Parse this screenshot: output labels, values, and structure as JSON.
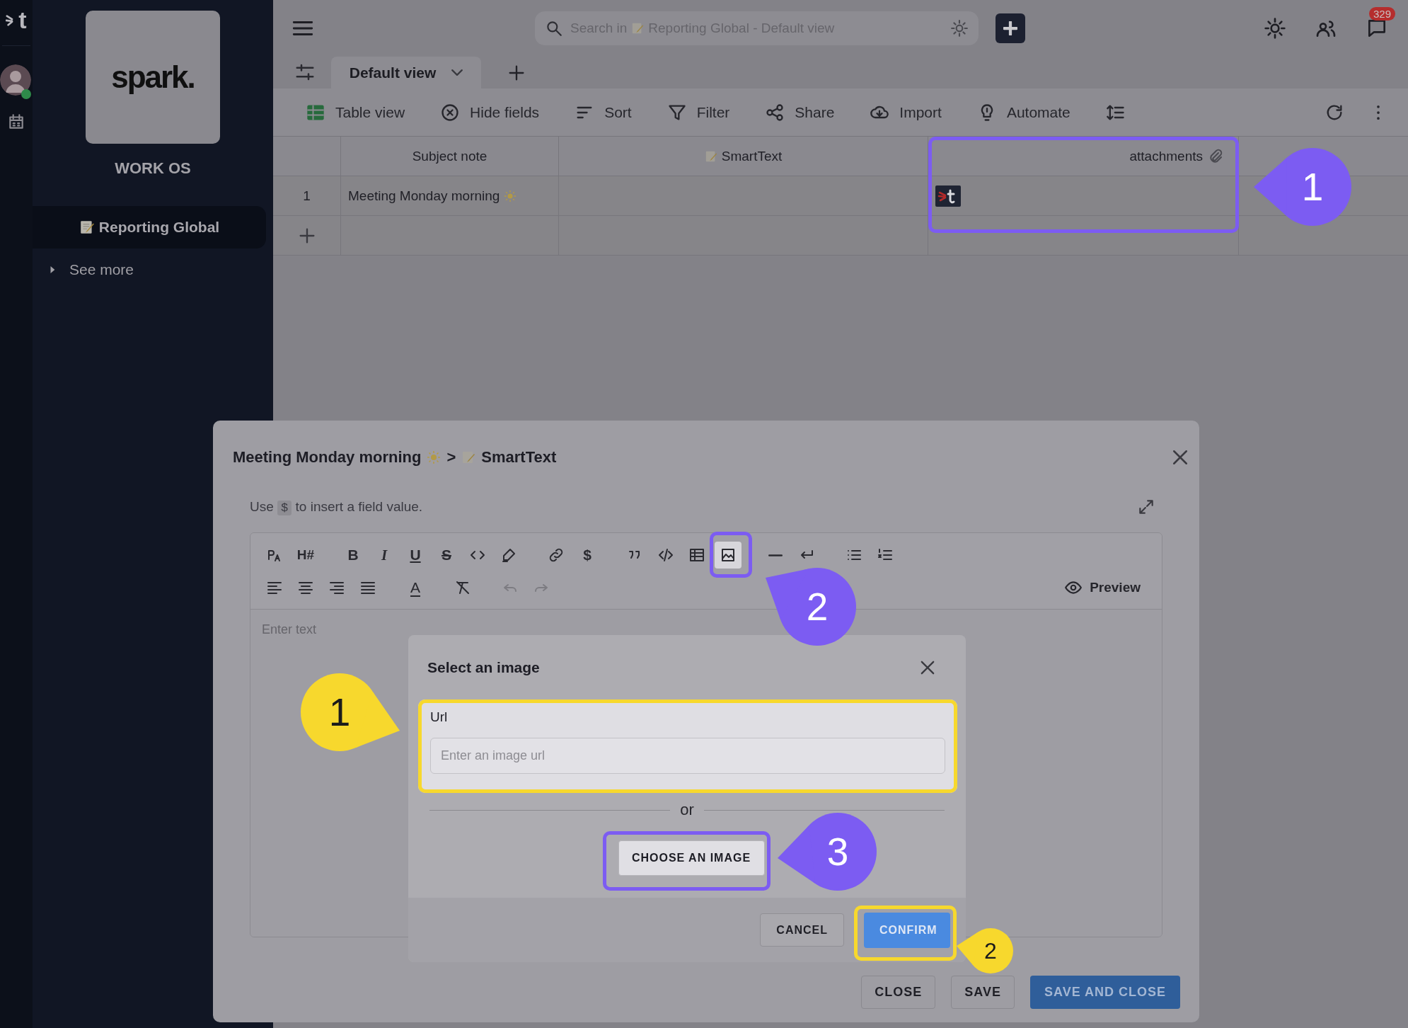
{
  "rail": {
    "logo_letter": "t",
    "user_online": true
  },
  "sidebar": {
    "brand_logo": "spark.",
    "workspace": "WORK OS",
    "items": [
      {
        "label": "Reporting Global",
        "selected": true
      }
    ],
    "see_more": "See more"
  },
  "topbar": {
    "search": {
      "prefix": "Search in",
      "scope": "Reporting Global - Default view"
    },
    "notification_count": "329"
  },
  "views": {
    "tabs": [
      {
        "label": "Default view",
        "selected": true
      }
    ]
  },
  "toolbar": [
    {
      "kind": "table",
      "label": "Table view"
    },
    {
      "kind": "hide",
      "label": "Hide fields"
    },
    {
      "kind": "sort",
      "label": "Sort"
    },
    {
      "kind": "filter",
      "label": "Filter"
    },
    {
      "kind": "share",
      "label": "Share"
    },
    {
      "kind": "import",
      "label": "Import"
    },
    {
      "kind": "automate",
      "label": "Automate"
    }
  ],
  "table": {
    "columns": [
      {
        "kind": "text",
        "label": "Subject note"
      },
      {
        "kind": "smarttext",
        "label": "SmartText"
      },
      {
        "kind": "attachment",
        "label": "attachments"
      }
    ],
    "rows": [
      {
        "number": "1",
        "subject": "Meeting Monday morning",
        "attachment": true
      }
    ]
  },
  "modal": {
    "breadcrumb": {
      "record": "Meeting Monday morning",
      "separator": ">",
      "field": "SmartText"
    },
    "hint": {
      "before": "Use",
      "code": "$",
      "after": "to insert a field value."
    },
    "tool_rows": [
      [
        {
          "kind": "font-size",
          "active": false,
          "disabled": false
        },
        {
          "kind": "heading",
          "glyph": "H#",
          "active": false,
          "disabled": false
        },
        {
          "kind": "bold",
          "glyph": "B",
          "active": false,
          "disabled": false
        },
        {
          "kind": "italic",
          "glyph": "I",
          "active": false,
          "disabled": false
        },
        {
          "kind": "underline",
          "glyph": "U",
          "active": false,
          "disabled": false
        },
        {
          "kind": "strike",
          "glyph": "S",
          "active": false,
          "disabled": false
        },
        {
          "kind": "code",
          "active": false,
          "disabled": false
        },
        {
          "kind": "highlight",
          "active": false,
          "disabled": false
        },
        {
          "kind": "link",
          "active": false,
          "disabled": false
        },
        {
          "kind": "variable",
          "glyph": "$",
          "active": false,
          "disabled": false
        },
        {
          "kind": "quote",
          "active": false,
          "disabled": false
        },
        {
          "kind": "code-block",
          "active": false,
          "disabled": false
        },
        {
          "kind": "table",
          "active": false,
          "disabled": false
        },
        {
          "kind": "image",
          "active": true,
          "disabled": false
        },
        {
          "kind": "hr",
          "active": false,
          "disabled": false
        },
        {
          "kind": "hard-break",
          "active": false,
          "disabled": false
        },
        {
          "kind": "bullet-list",
          "active": false,
          "disabled": false
        },
        {
          "kind": "ordered-list",
          "active": false,
          "disabled": false
        }
      ],
      [
        {
          "kind": "align-left",
          "active": false,
          "disabled": false
        },
        {
          "kind": "align-center",
          "active": false,
          "disabled": false
        },
        {
          "kind": "align-right",
          "active": false,
          "disabled": false
        },
        {
          "kind": "justify",
          "active": false,
          "disabled": false
        },
        {
          "kind": "text-color",
          "glyph": "A",
          "active": false,
          "disabled": false
        },
        {
          "kind": "clear-format",
          "active": false,
          "disabled": false
        },
        {
          "kind": "undo",
          "active": false,
          "disabled": true
        },
        {
          "kind": "redo",
          "active": false,
          "disabled": true
        }
      ]
    ],
    "preview": "Preview",
    "placeholder": "Enter text",
    "buttons": [
      {
        "kind": "secondary",
        "label": "CLOSE"
      },
      {
        "kind": "secondary",
        "label": "SAVE"
      },
      {
        "kind": "primary",
        "label": "SAVE AND CLOSE"
      }
    ]
  },
  "dialog": {
    "title": "Select an image",
    "url_label": "Url",
    "url_placeholder": "Enter an image url",
    "divider": "or",
    "choose": "CHOOSE AN IMAGE",
    "buttons": [
      {
        "kind": "secondary",
        "label": "CANCEL"
      },
      {
        "kind": "primary",
        "label": "CONFIRM"
      }
    ]
  },
  "annotations": {
    "attachments_column": {
      "number": "1",
      "color": "#7c5cf2"
    },
    "image_tool": {
      "number": "2",
      "color": "#7c5cf2"
    },
    "url_field": {
      "number": "1",
      "color": "#f7d82d"
    },
    "choose_button": {
      "number": "3",
      "color": "#7c5cf2"
    },
    "confirm_button": {
      "number": "2",
      "color": "#f7d82d"
    }
  }
}
